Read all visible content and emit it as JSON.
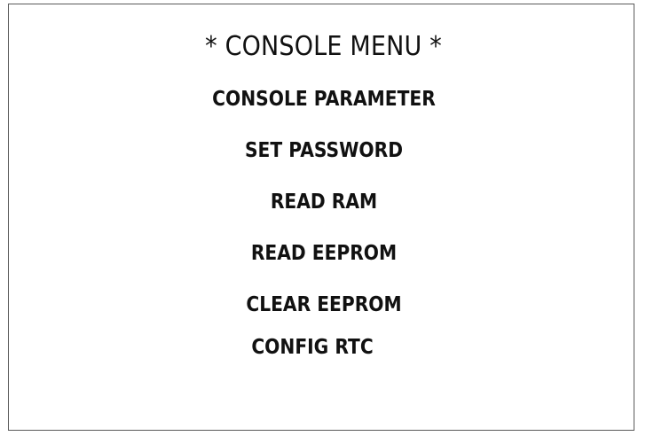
{
  "menu": {
    "title": "* CONSOLE MENU *",
    "items": [
      {
        "label": "CONSOLE PARAMETER"
      },
      {
        "label": "SET PASSWORD"
      },
      {
        "label": "READ RAM"
      },
      {
        "label": "READ EEPROM"
      },
      {
        "label": "CLEAR EEPROM"
      },
      {
        "label": "CONFIG RTC"
      }
    ]
  }
}
